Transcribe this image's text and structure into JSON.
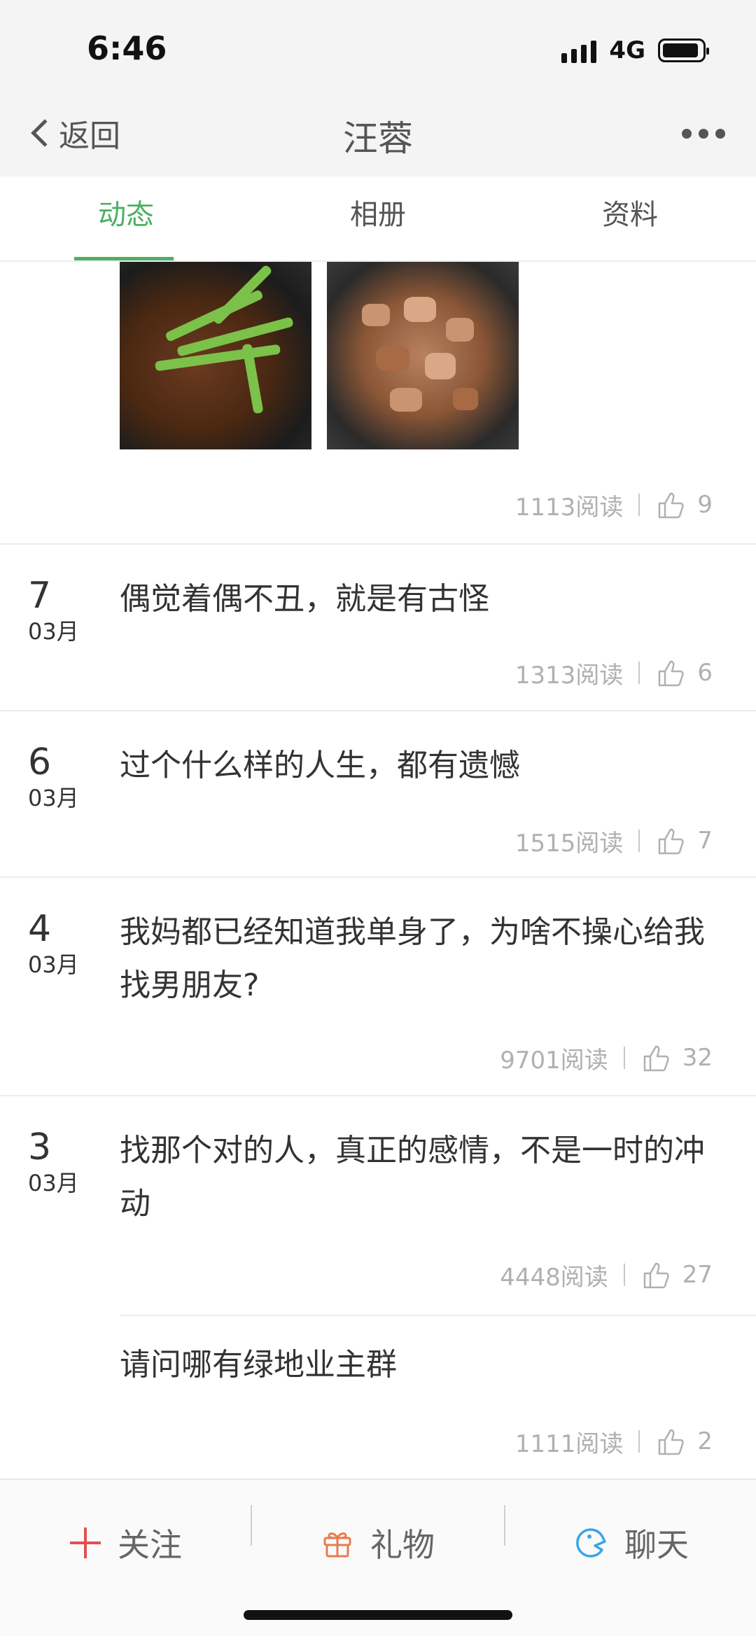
{
  "status_bar": {
    "time": "6:46",
    "network": "4G"
  },
  "nav": {
    "back_label": "返回",
    "title": "汪蓉"
  },
  "tabs": [
    {
      "label": "动态",
      "active": true
    },
    {
      "label": "相册",
      "active": false
    },
    {
      "label": "资料",
      "active": false
    }
  ],
  "posts": [
    {
      "day": "",
      "month": "",
      "text": "",
      "reads": "1113阅读",
      "likes": "9"
    },
    {
      "day": "7",
      "month": "03月",
      "text": "偶觉着偶不丑，就是有古怪",
      "reads": "1313阅读",
      "likes": "6"
    },
    {
      "day": "6",
      "month": "03月",
      "text": "过个什么样的人生，都有遗憾",
      "reads": "1515阅读",
      "likes": "7"
    },
    {
      "day": "4",
      "month": "03月",
      "text": "我妈都已经知道我单身了，为啥不操心给我找男朋友?",
      "reads": "9701阅读",
      "likes": "32"
    },
    {
      "day": "3",
      "month": "03月",
      "text": "找那个对的人，真正的感情，不是一时的冲动",
      "reads": "4448阅读",
      "likes": "27"
    },
    {
      "day": "",
      "month": "",
      "text": "请问哪有绿地业主群",
      "reads": "1111阅读",
      "likes": "2"
    }
  ],
  "bottom_bar": {
    "follow_label": "关注",
    "gift_label": "礼物",
    "chat_label": "聊天"
  },
  "colors": {
    "accent": "#4caf62",
    "follow": "#e35050",
    "gift": "#e87b4f",
    "chat": "#3aa6e8",
    "meta": "#b0b0b0"
  }
}
